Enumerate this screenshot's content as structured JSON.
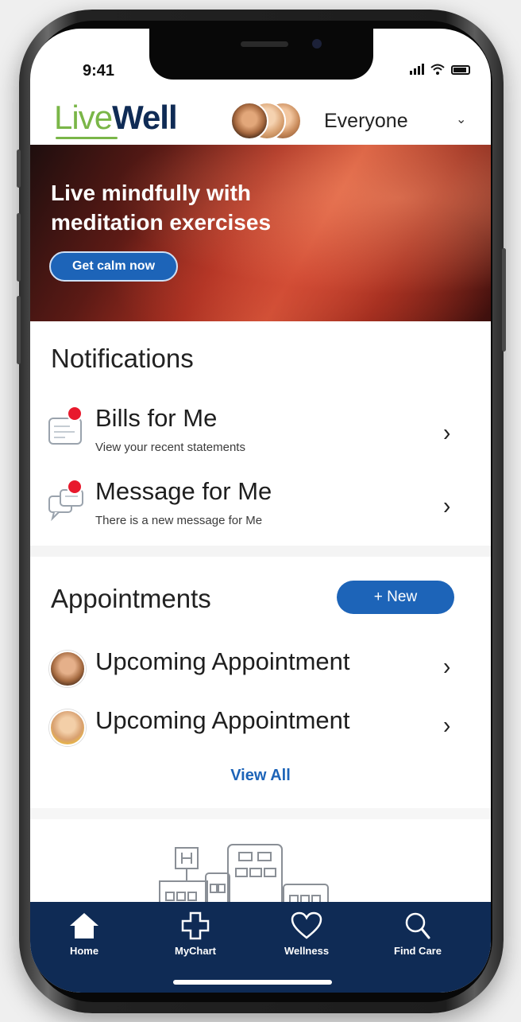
{
  "status": {
    "time": "9:41"
  },
  "header": {
    "logo_live": "Live",
    "logo_well": "Well",
    "profile_selector": "Everyone"
  },
  "banner": {
    "title": "Live mindfully with meditation exercises",
    "button_label": "Get calm now"
  },
  "notifications": {
    "title": "Notifications",
    "items": [
      {
        "title": "Bills for Me",
        "subtitle": "View your recent statements",
        "icon": "bill-icon"
      },
      {
        "title": "Message for Me",
        "subtitle": "There is a new message for Me",
        "icon": "message-icon"
      }
    ]
  },
  "appointments": {
    "title": "Appointments",
    "new_button": "+ New",
    "items": [
      {
        "title": "Upcoming Appointment"
      },
      {
        "title": "Upcoming Appointment"
      }
    ],
    "view_all": "View All"
  },
  "tabbar": {
    "items": [
      {
        "label": "Home",
        "icon": "home-icon"
      },
      {
        "label": "MyChart",
        "icon": "mychart-cross-icon"
      },
      {
        "label": "Wellness",
        "icon": "heart-icon"
      },
      {
        "label": "Find Care",
        "icon": "search-icon"
      }
    ]
  },
  "colors": {
    "brand_navy": "#0f2b55",
    "brand_green": "#7ab648",
    "accent_blue": "#1d64b8",
    "badge_red": "#e8192c"
  }
}
